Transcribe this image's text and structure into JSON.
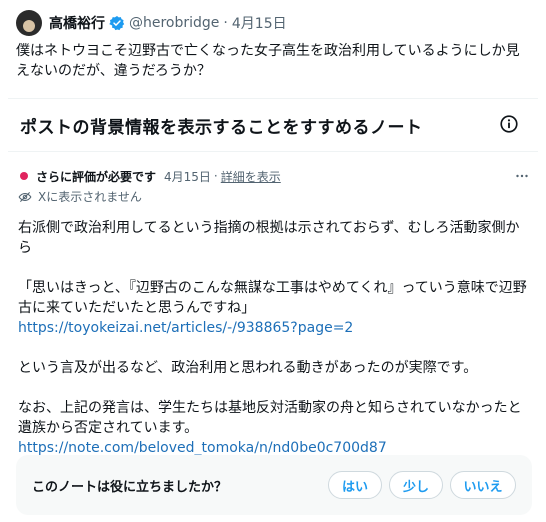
{
  "post": {
    "author_name": "高橋裕行",
    "handle": "@herobridge",
    "separator": "·",
    "date": "4月15日",
    "text": "僕はネトウヨこそ辺野古で亡くなった女子高生を政治利用しているようにしか見えないのだが、違うだろうか？"
  },
  "note_banner": {
    "title": "ポストの背景情報を表示することをすすめるノート"
  },
  "note": {
    "status": "さらに評価が必要です",
    "date": "4月15日",
    "separator": "·",
    "details_link": "詳細を表示",
    "visibility": "Xに表示されません",
    "paragraph1": "右派側で政治利用してるという指摘の根拠は示されておらず、むしろ活動家側から",
    "quote": "「思いはきっと、『辺野古のこんな無謀な工事はやめてくれ』っていう意味で辺野古に来ていただいたと思うんですね」",
    "link1": "https://toyokeizai.net/articles/-/938865?page=2",
    "paragraph2": "という言及が出るなど、政治利用と思われる動きがあったのが実際です。",
    "paragraph3": "なお、上記の発言は、学生たちは基地反対活動家の舟と知らされていなかったと遺族から否定されています。",
    "link2": "https://note.com/beloved_tomoka/n/nd0be0c700d87"
  },
  "feedback": {
    "question": "このノートは役に立ちましたか？",
    "yes": "はい",
    "somewhat": "少し",
    "no": "いいえ"
  },
  "colors": {
    "accent": "#1d9bf0",
    "link": "#1d6fb8",
    "status_dot": "#e0245e",
    "muted_text": "#536471"
  }
}
